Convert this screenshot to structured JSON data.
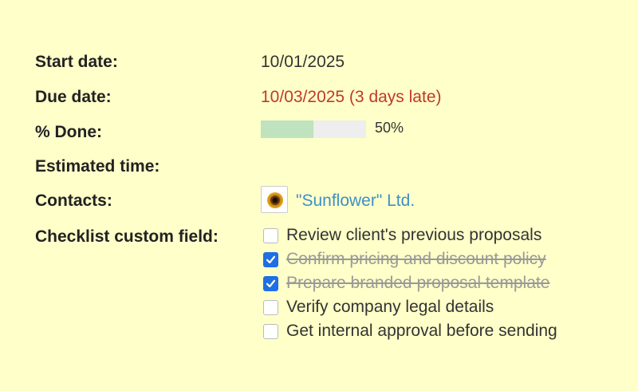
{
  "fields": {
    "start_date": {
      "label": "Start date:",
      "value": "10/01/2025"
    },
    "due_date": {
      "label": "Due date:",
      "value": "10/03/2025 (3 days late)",
      "color": "#c0392b"
    },
    "done": {
      "label": "% Done:",
      "percent": 50,
      "text": "50%",
      "fill_color": "#bfe2bf"
    },
    "estimated_time": {
      "label": "Estimated time:",
      "value": ""
    },
    "contacts": {
      "label": "Contacts:",
      "name": "\"Sunflower\" Ltd.",
      "icon": "sunflower-icon",
      "link_color": "#3f8fc8"
    },
    "checklist": {
      "label": "Checklist custom field:",
      "items": [
        {
          "text": "Review client's previous proposals",
          "checked": false
        },
        {
          "text": "Confirm pricing and discount policy",
          "checked": true
        },
        {
          "text": "Prepare branded proposal template",
          "checked": true
        },
        {
          "text": "Verify company legal details",
          "checked": false
        },
        {
          "text": "Get internal approval before sending",
          "checked": false
        }
      ]
    }
  },
  "colors": {
    "background": "#ffffc9",
    "checkbox_checked": "#1f6fe5"
  }
}
